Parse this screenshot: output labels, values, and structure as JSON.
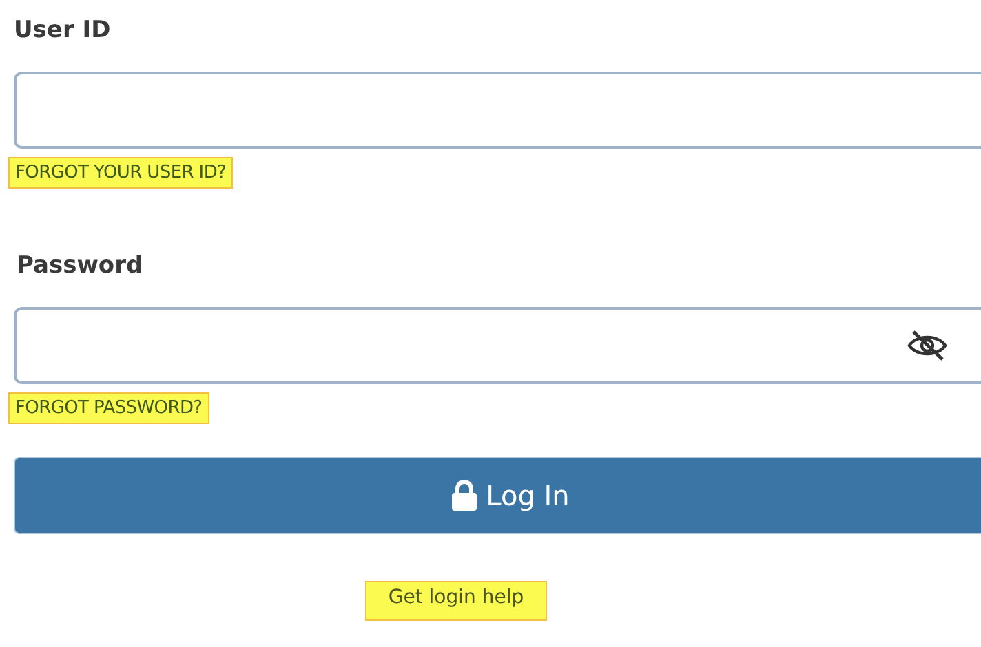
{
  "user_id": {
    "label": "User ID",
    "link": {
      "text": "FORGOT YOUR USER ID?",
      "highlighted": true
    }
  },
  "password": {
    "label": "Password",
    "password_visible": false,
    "link": {
      "text": "FORGOT PASSWORD?",
      "highlighted": true
    }
  },
  "login_button": {
    "label": "Log In"
  },
  "help_link": {
    "text": "Get login help",
    "highlighted": true
  }
}
